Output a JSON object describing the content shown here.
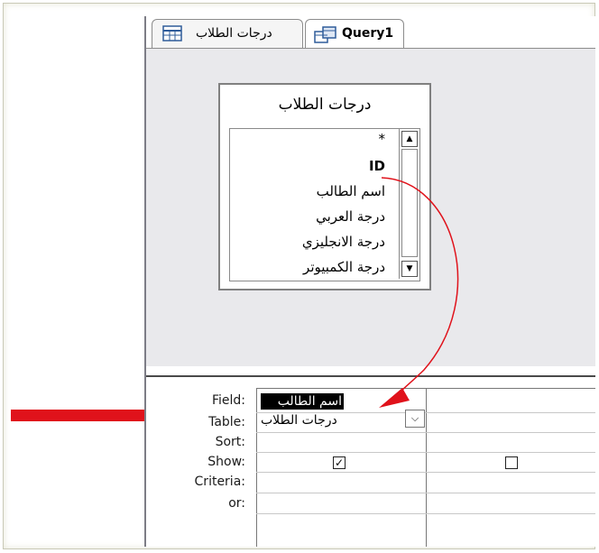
{
  "tabs": [
    {
      "label": "درجات الطلاب",
      "icon": "table-icon"
    },
    {
      "label": "Query1",
      "icon": "query-icon"
    }
  ],
  "table_box": {
    "title": "درجات الطلاب",
    "fields": [
      "*",
      "ID",
      "اسم الطالب",
      "درجة العربي",
      "درجة الانجليزي",
      "درجة الكمبيوتر"
    ]
  },
  "grid": {
    "row_labels": [
      "Field:",
      "Table:",
      "Sort:",
      "Show:",
      "Criteria:",
      "or:"
    ],
    "columns": [
      {
        "field": "اسم الطالب",
        "table": "درجات الطلاب",
        "show": true
      },
      {
        "field": "",
        "table": "",
        "show": false
      }
    ]
  },
  "colors": {
    "annotation_arrow": "#e0121b",
    "selection": "#000000"
  }
}
